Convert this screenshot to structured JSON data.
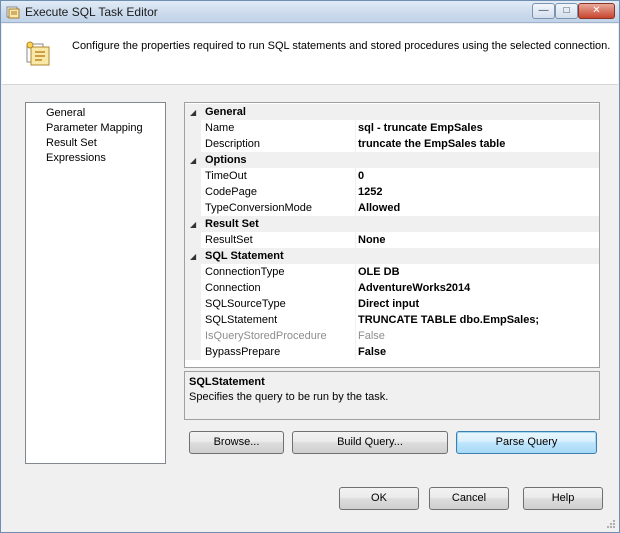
{
  "window": {
    "title": "Execute SQL Task Editor",
    "buttons": {
      "minimize": "—",
      "maximize": "□",
      "close": "✕"
    }
  },
  "header": {
    "text": "Configure the properties required to run SQL statements and stored procedures using the selected connection."
  },
  "nav": {
    "items": [
      {
        "label": "General"
      },
      {
        "label": "Parameter Mapping"
      },
      {
        "label": "Result Set"
      },
      {
        "label": "Expressions"
      }
    ]
  },
  "properties": {
    "categories": [
      {
        "label": "General",
        "rows": [
          {
            "name": "Name",
            "value": "sql - truncate EmpSales"
          },
          {
            "name": "Description",
            "value": "truncate the EmpSales table"
          }
        ]
      },
      {
        "label": "Options",
        "rows": [
          {
            "name": "TimeOut",
            "value": "0"
          },
          {
            "name": "CodePage",
            "value": "1252"
          },
          {
            "name": "TypeConversionMode",
            "value": "Allowed"
          }
        ]
      },
      {
        "label": "Result Set",
        "rows": [
          {
            "name": "ResultSet",
            "value": "None"
          }
        ]
      },
      {
        "label": "SQL Statement",
        "rows": [
          {
            "name": "ConnectionType",
            "value": "OLE DB"
          },
          {
            "name": "Connection",
            "value": "AdventureWorks2014"
          },
          {
            "name": "SQLSourceType",
            "value": "Direct input"
          },
          {
            "name": "SQLStatement",
            "value": "TRUNCATE TABLE dbo.EmpSales;"
          },
          {
            "name": "IsQueryStoredProcedure",
            "value": "False"
          },
          {
            "name": "BypassPrepare",
            "value": "False"
          }
        ]
      }
    ]
  },
  "description": {
    "title": "SQLStatement",
    "text": "Specifies the query to be run by the task."
  },
  "actions": {
    "browse": "Browse...",
    "build_query": "Build Query...",
    "parse_query": "Parse Query"
  },
  "footer": {
    "ok": "OK",
    "cancel": "Cancel",
    "help": "Help"
  }
}
